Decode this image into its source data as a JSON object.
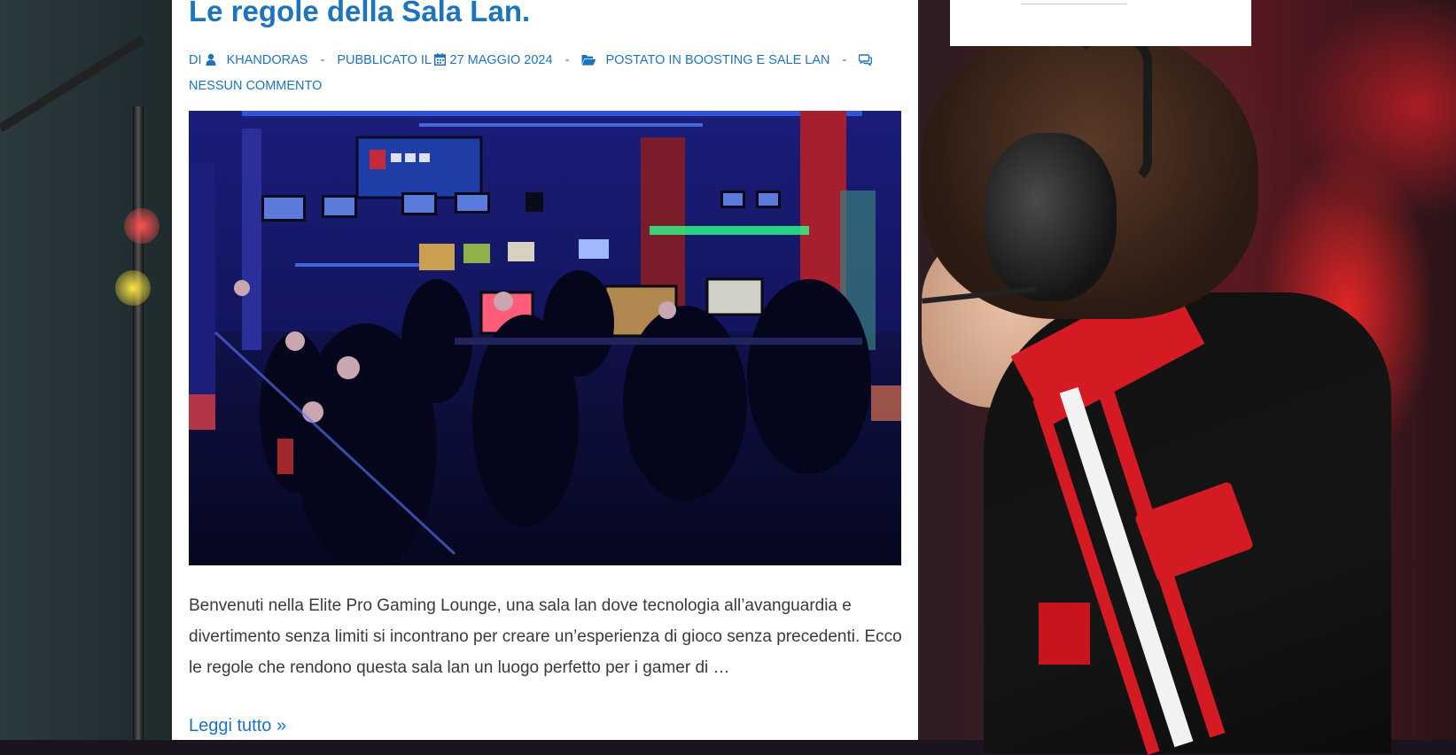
{
  "post": {
    "title": "Le regole della Sala Lan.",
    "meta": {
      "by_label": "DI",
      "author": "KHANDORAS",
      "published_label": "PUBBLICATO IL",
      "date": "27 MAGGIO 2024",
      "posted_in_label": "POSTATO IN",
      "category": "BOOSTING E SALE LAN",
      "comments": "NESSUN COMMENTO",
      "separator": "-"
    },
    "excerpt": "Benvenuti nella Elite Pro Gaming Lounge, una sala lan dove tecnologia all’avanguardia e divertimento senza limiti si incontrano per creare un’esperienza di gioco senza precedenti. Ecco le regole che rendono questa sala lan un luogo perfetto per i gamer di …",
    "read_more": "Leggi tutto »"
  },
  "icons": {
    "author": "user-icon",
    "date": "calendar-icon",
    "category": "folder-open-icon",
    "comments": "comments-icon"
  },
  "colors": {
    "link": "#1e73be",
    "text": "#3a3a3a",
    "card": "#ffffff"
  }
}
